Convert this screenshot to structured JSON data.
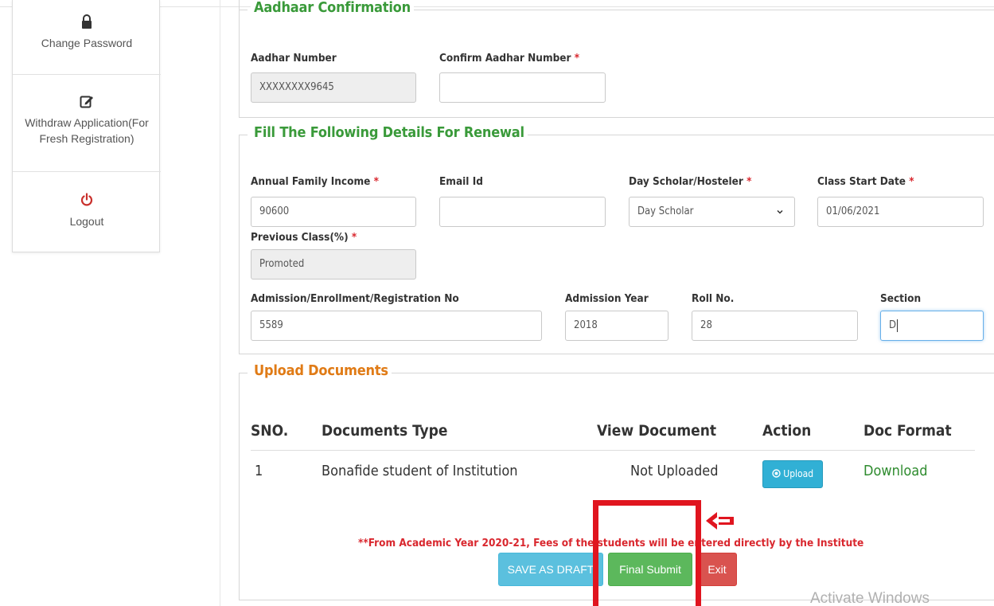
{
  "sidebar": {
    "items": [
      {
        "label": "Change Password",
        "icon": "lock-icon"
      },
      {
        "label": "Withdraw Application(For Fresh Registration)",
        "icon": "edit-icon"
      },
      {
        "label": "Logout",
        "icon": "power-icon"
      }
    ]
  },
  "aadhaar": {
    "legend": "Aadhaar Confirmation",
    "aadhar_label": "Aadhar Number",
    "aadhar_value": "XXXXXXXX9645",
    "confirm_label": "Confirm Aadhar Number",
    "confirm_value": "",
    "required_mark": "*"
  },
  "renewal": {
    "legend": "Fill The Following Details For Renewal",
    "income_label": "Annual Family Income",
    "income_value": "90600",
    "email_label": "Email Id",
    "email_value": "",
    "scholar_label": "Day Scholar/Hosteler",
    "scholar_value": "Day Scholar",
    "class_start_label": "Class Start Date",
    "class_start_value": "01/06/2021",
    "prev_class_label": "Previous Class(%)",
    "prev_class_value": "Promoted",
    "admission_no_label": "Admission/Enrollment/Registration No",
    "admission_no_value": "5589",
    "admission_year_label": "Admission Year",
    "admission_year_value": "2018",
    "roll_label": "Roll No.",
    "roll_value": "28",
    "section_label": "Section",
    "section_value": "D"
  },
  "documents": {
    "legend": "Upload Documents",
    "headers": [
      "SNO.",
      "Documents Type",
      "View Document",
      "Action",
      "Doc Format"
    ],
    "rows": [
      {
        "sno": "1",
        "type": "Bonafide student of Institution",
        "view": "Not Uploaded",
        "action": "Upload",
        "format": "Download"
      }
    ]
  },
  "notice": "**From Academic Year 2020-21, Fees of the students will be entered directly by the Institute",
  "buttons": {
    "draft": "SAVE AS DRAFT",
    "final": "Final Submit",
    "exit": "Exit"
  },
  "watermark": "Activate Windows",
  "colors": {
    "legend_green": "#3a9a3a",
    "legend_orange": "#e07b16",
    "required": "#d9272e",
    "annotation": "#e0151f"
  }
}
